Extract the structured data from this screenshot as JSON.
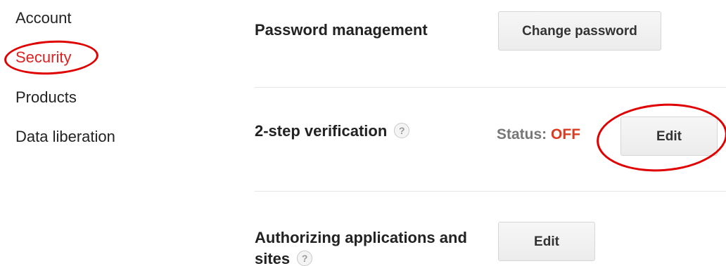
{
  "sidebar": {
    "items": [
      {
        "label": "Account"
      },
      {
        "label": "Security"
      },
      {
        "label": "Products"
      },
      {
        "label": "Data liberation"
      }
    ],
    "active_index": 1
  },
  "sections": {
    "password": {
      "label": "Password management",
      "button_label": "Change password"
    },
    "two_step": {
      "label": "2-step verification",
      "help_icon": "?",
      "status_label": "Status:",
      "status_value": "OFF",
      "button_label": "Edit"
    },
    "authorizing": {
      "label": "Authorizing applications and sites",
      "help_icon": "?",
      "button_label": "Edit"
    }
  },
  "colors": {
    "active_nav": "#dd2222",
    "status_off": "#dd3b1f",
    "annotation": "#e00000"
  }
}
